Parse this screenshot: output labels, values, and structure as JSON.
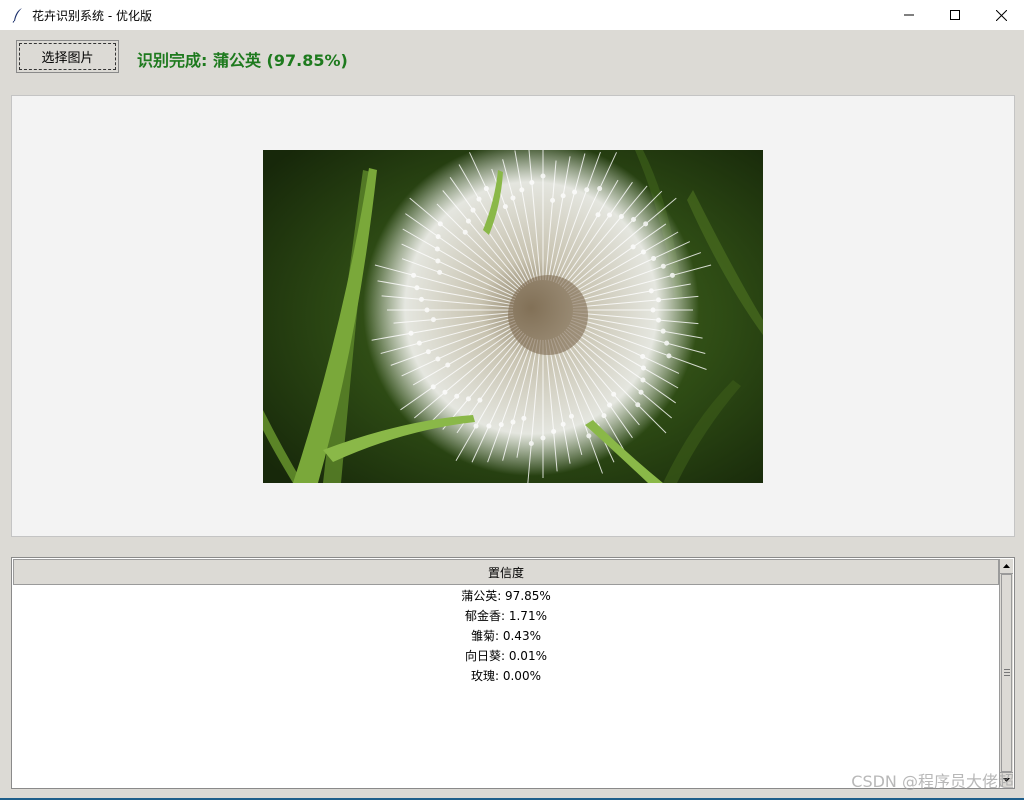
{
  "window": {
    "title": "花卉识别系统 - 优化版"
  },
  "toolbar": {
    "select_label": "选择图片",
    "status": "识别完成: 蒲公英 (97.85%)",
    "status_color": "#1e7a1e"
  },
  "preview": {
    "image_subject": "dandelion-seed-head-photo"
  },
  "results": {
    "header": "置信度",
    "rows": [
      "蒲公英: 97.85%",
      "郁金香: 1.71%",
      "雏菊: 0.43%",
      "向日葵: 0.01%",
      "玫瑰: 0.00%"
    ]
  },
  "watermark": "CSDN @程序员大佬超",
  "icons": {
    "app": "feather-icon",
    "minimize": "minimize-icon",
    "maximize": "maximize-icon",
    "close": "close-icon"
  }
}
